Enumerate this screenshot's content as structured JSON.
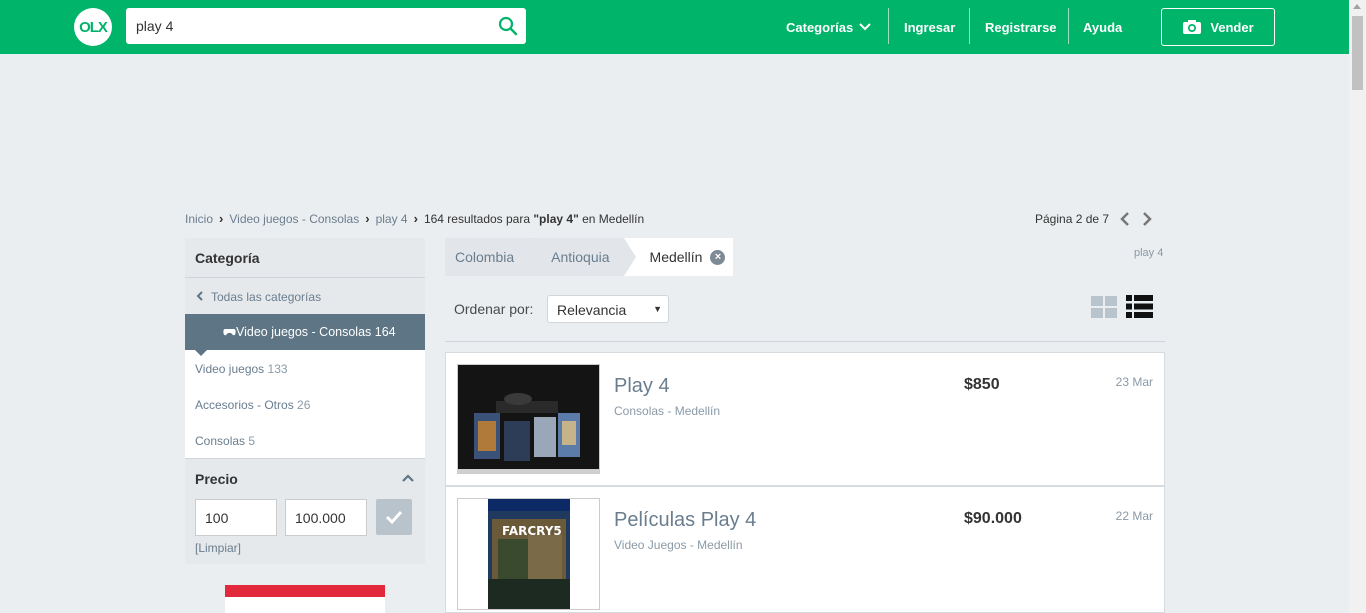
{
  "header": {
    "logo_text": "OLX",
    "search": {
      "value": "play 4",
      "placeholder": ""
    },
    "nav": {
      "categories": "Categorías",
      "login": "Ingresar",
      "register": "Registrarse",
      "help": "Ayuda",
      "sell": "Vender"
    }
  },
  "breadcrumb": {
    "items": [
      "Inicio",
      "Video juegos - Consolas",
      "play 4"
    ],
    "results_count": "164 resultados para ",
    "query": "\"play 4\"",
    "location_text": " en Medellín"
  },
  "pagination": {
    "label": "Página 2 de 7"
  },
  "sidebar": {
    "category_title": "Categoría",
    "all_categories": "Todas las categorías",
    "active_category": "Video juegos - Consolas 164",
    "subcategories": [
      {
        "label": "Video juegos",
        "count": "133"
      },
      {
        "label": "Accesorios - Otros",
        "count": "26"
      },
      {
        "label": "Consolas",
        "count": "5"
      }
    ],
    "price": {
      "title": "Precio",
      "min": "100",
      "max": "100.000",
      "clear": "[Limpiar]"
    }
  },
  "location_filter": {
    "tabs": [
      "Colombia",
      "Antioquia",
      "Medellín"
    ],
    "search_tag": "play 4"
  },
  "sort": {
    "label": "Ordenar por:",
    "selected": "Relevancia"
  },
  "listings": [
    {
      "title": "Play 4",
      "subtitle": "Consolas - Medellín",
      "price": "$850",
      "date": "23 Mar"
    },
    {
      "title": "Películas Play 4",
      "subtitle": "Video Juegos - Medellín",
      "price": "$90.000",
      "date": "22 Mar",
      "thumb_text": "FARCRY5"
    }
  ],
  "colors": {
    "brand": "#00b46a",
    "active_category": "#5e7585",
    "link": "#6a7d8e"
  }
}
